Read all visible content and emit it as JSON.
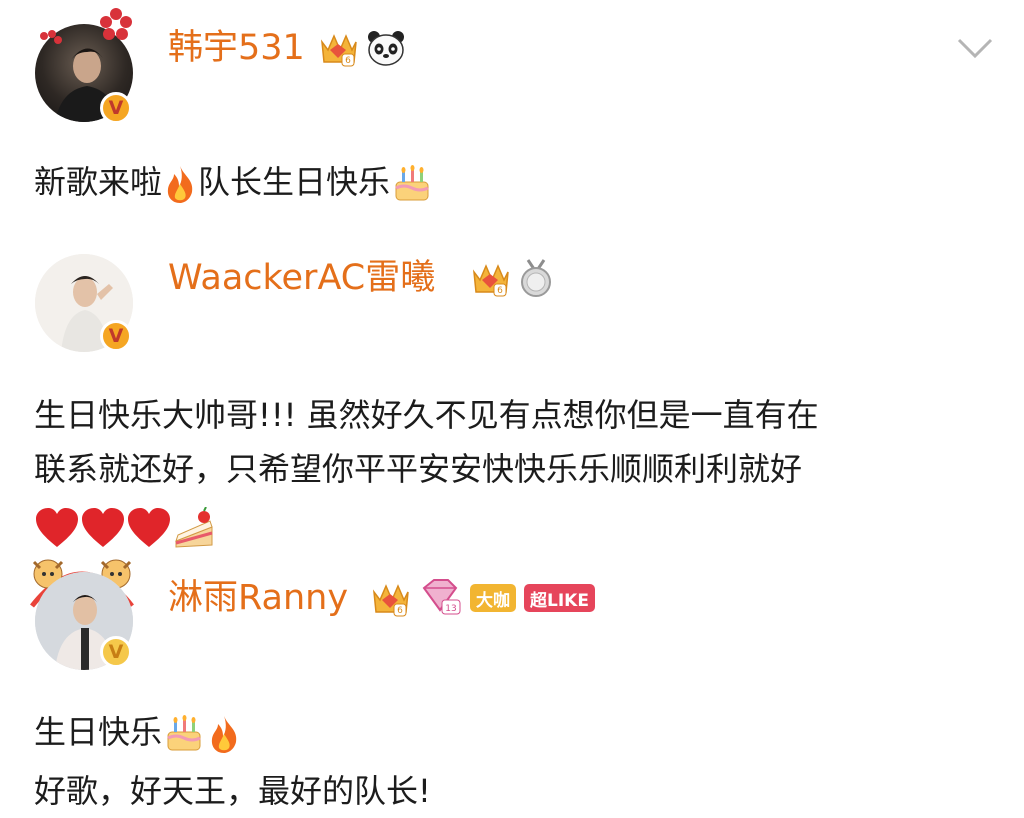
{
  "comments": [
    {
      "username": "韩宇531",
      "text_before": "新歌来啦",
      "text_middle": "队长生日快乐",
      "icons": [
        "crown-level-6-icon",
        "panda-icon"
      ],
      "level": "6"
    },
    {
      "username": "WaackerAC雷曦",
      "line1": "生日快乐大帅哥!!! 虽然好久不见有点想你但是一直有在",
      "line2": "联系就还好，只希望你平平安安快快乐乐顺顺利利就好",
      "icons": [
        "crown-level-6-icon",
        "silver-medal-icon"
      ],
      "level": "6"
    },
    {
      "username": "淋雨Ranny",
      "text": "生日快乐",
      "tag_daka": "大咖",
      "tag_chaolike": "超LIKE",
      "level": "6",
      "diamond_level": "13",
      "line_partial": "好歌，好天王，最好的队长!"
    }
  ],
  "colors": {
    "username": "#e46f1a",
    "verified": "#f5a623",
    "text": "#1c1c1c"
  }
}
